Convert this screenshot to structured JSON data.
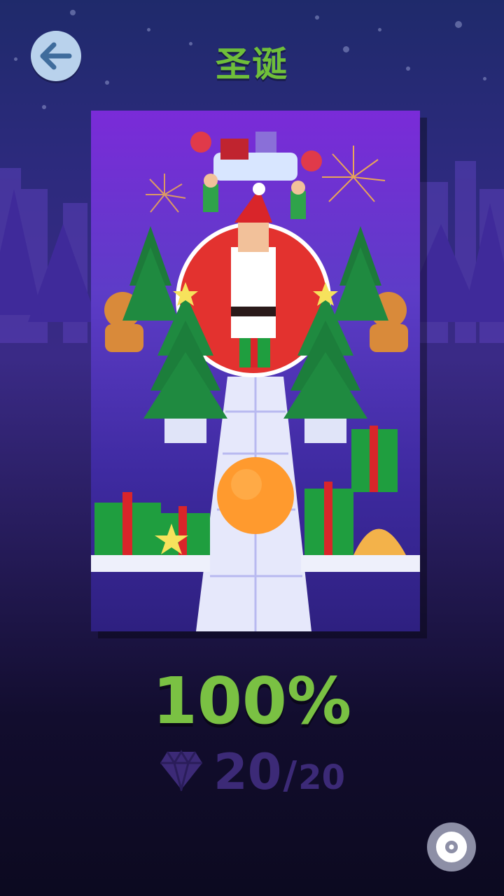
{
  "header": {
    "title": "圣诞"
  },
  "result": {
    "percent": "100%",
    "gems_collected": "20",
    "gems_separator": "/",
    "gems_total": "20"
  },
  "icons": {
    "back": "arrow-left-icon",
    "gem": "diamond-icon",
    "music": "music-disc-icon"
  },
  "colors": {
    "title": "#6fbf3a",
    "percent": "#7ac143",
    "gems": "#3c2a77",
    "back_button": "#b9d2ec",
    "disc_button": "#8d8fa6",
    "ball": "#ff9a2e"
  }
}
